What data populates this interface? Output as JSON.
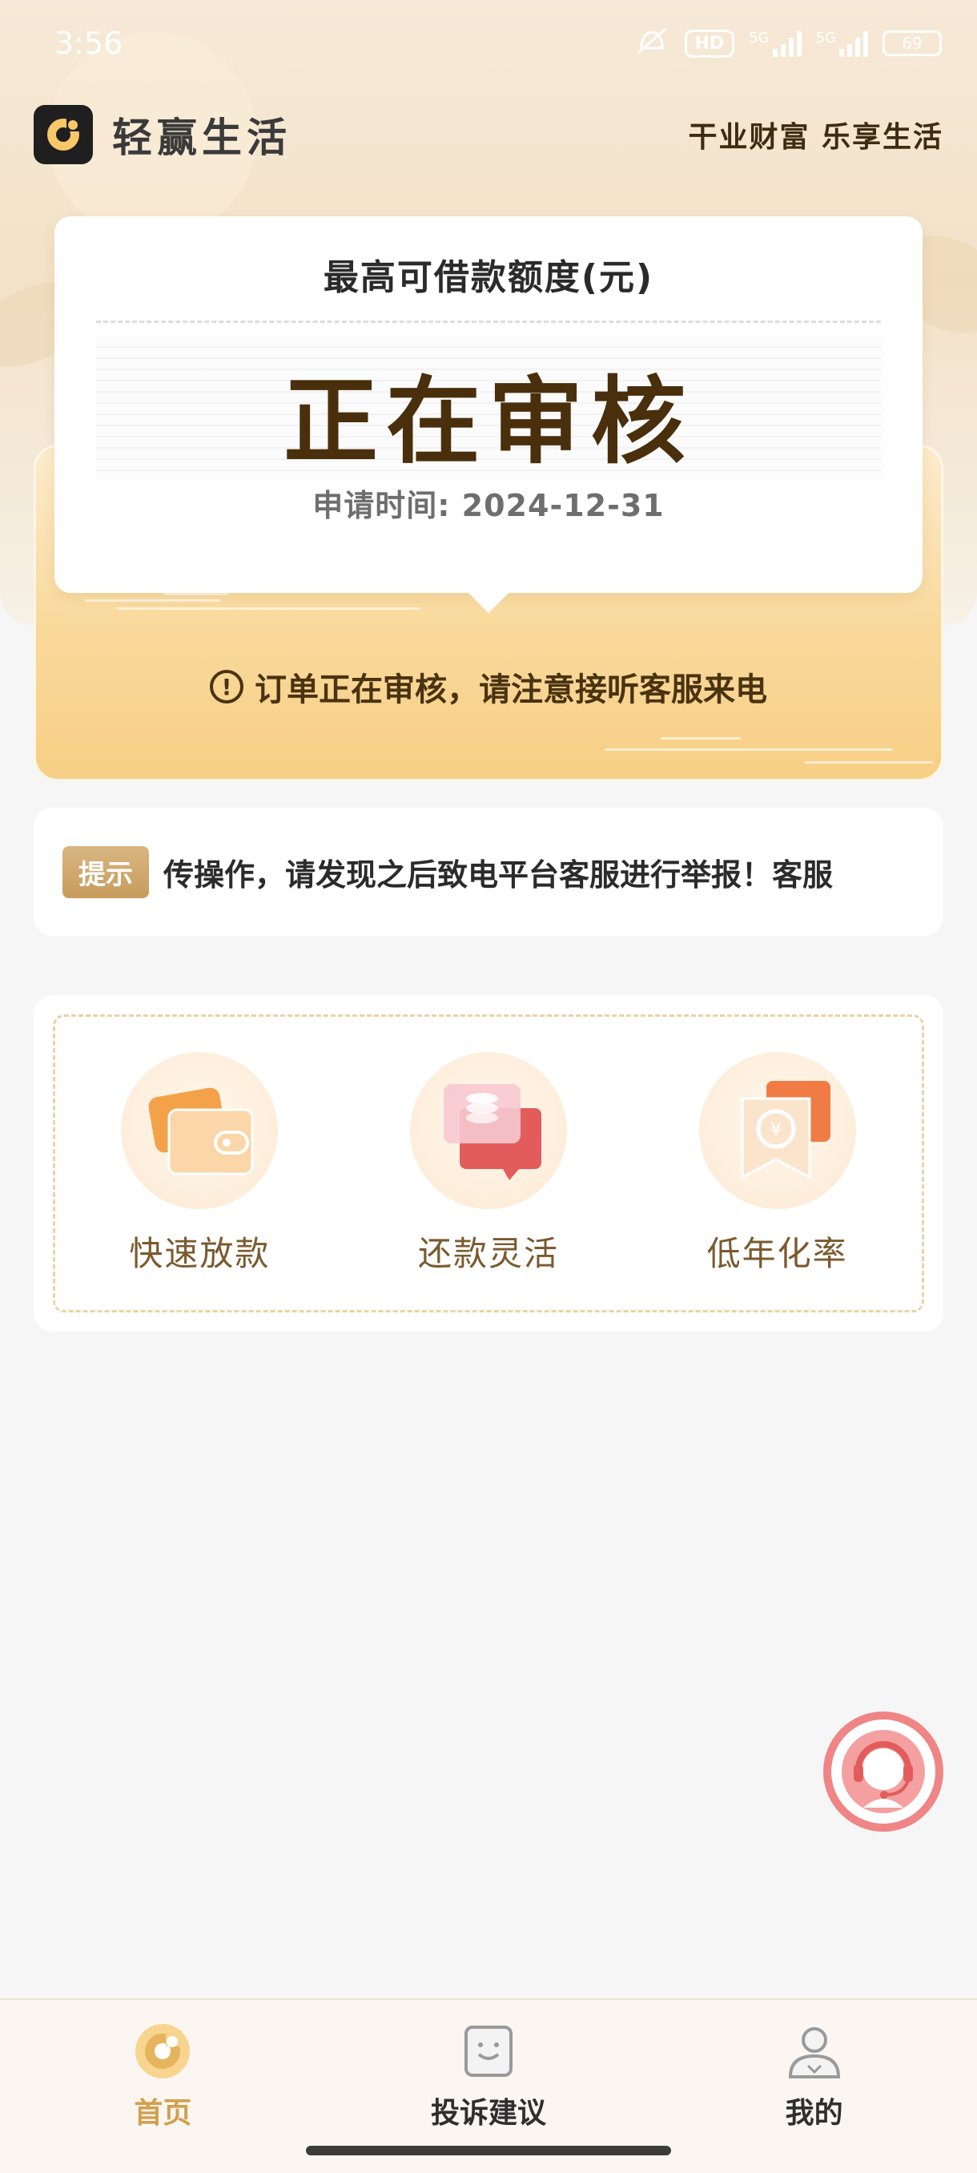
{
  "status_bar": {
    "time": "3:56",
    "hd_label": "HD",
    "network_1": "5G",
    "network_2": "5G",
    "battery": "69"
  },
  "header": {
    "brand_name": "轻赢生活",
    "slogan": "干业财富 乐享生活"
  },
  "quota_card": {
    "title": "最高可借款额度(元)",
    "status": "正在审核",
    "apply_time": "申请时间: 2024-12-31"
  },
  "notice": {
    "text": "订单正在审核，请注意接听客服来电"
  },
  "tip": {
    "badge": "提示",
    "text": "传操作，请发现之后致电平台客服进行举报！客服"
  },
  "features": [
    {
      "label": "快速放款",
      "icon": "wallet-card-icon"
    },
    {
      "label": "还款灵活",
      "icon": "chat-coins-icon"
    },
    {
      "label": "低年化率",
      "icon": "money-bag-icon"
    }
  ],
  "tabs": [
    {
      "label": "首页",
      "icon": "home-icon",
      "active": true
    },
    {
      "label": "投诉建议",
      "icon": "complaint-bag-icon",
      "active": false
    },
    {
      "label": "我的",
      "icon": "user-profile-icon",
      "active": false
    }
  ],
  "colors": {
    "accent_gold": "#d2a04e",
    "status_text": "#4a2f0d",
    "cs_ring": "#ef8585"
  }
}
